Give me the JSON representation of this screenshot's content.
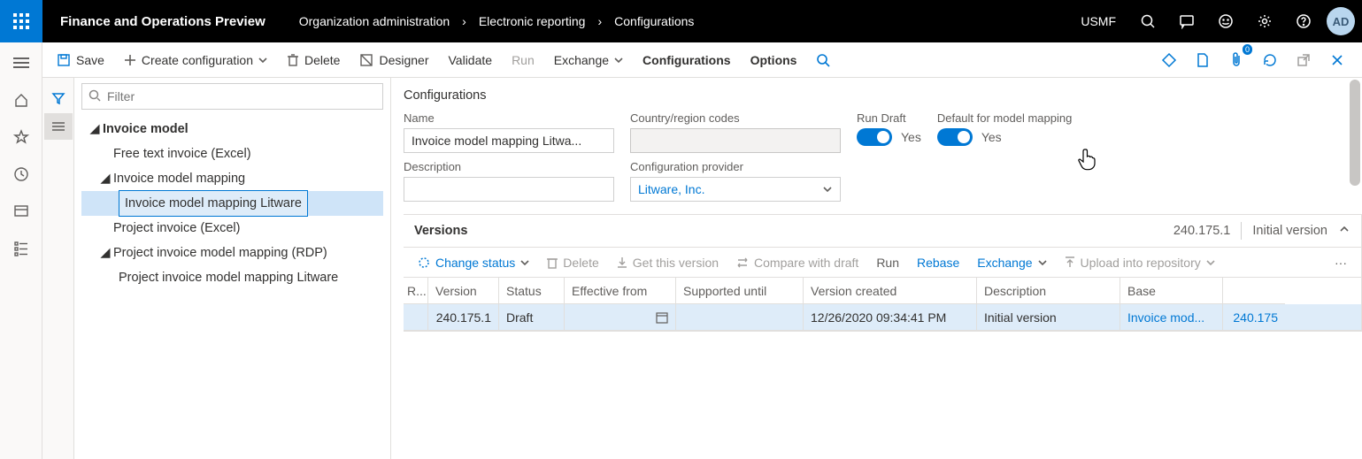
{
  "header": {
    "app_title": "Finance and Operations Preview",
    "breadcrumbs": [
      "Organization administration",
      "Electronic reporting",
      "Configurations"
    ],
    "company": "USMF",
    "avatar": "AD"
  },
  "toolbar": {
    "save": "Save",
    "create": "Create configuration",
    "delete": "Delete",
    "designer": "Designer",
    "validate": "Validate",
    "run": "Run",
    "exchange": "Exchange",
    "configurations": "Configurations",
    "options": "Options"
  },
  "filter": {
    "placeholder": "Filter"
  },
  "tree": {
    "root": "Invoice model",
    "items": [
      "Free text invoice (Excel)",
      "Invoice model mapping",
      "Invoice model mapping Litware",
      "Project invoice (Excel)",
      "Project invoice model mapping (RDP)",
      "Project invoice model mapping Litware"
    ]
  },
  "section": {
    "title": "Configurations",
    "name_label": "Name",
    "name_value": "Invoice model mapping Litwa...",
    "desc_label": "Description",
    "desc_value": "",
    "crc_label": "Country/region codes",
    "crc_value": "",
    "provider_label": "Configuration provider",
    "provider_value": "Litware, Inc.",
    "run_draft_label": "Run Draft",
    "run_draft_value": "Yes",
    "default_mm_label": "Default for model mapping",
    "default_mm_value": "Yes"
  },
  "versions": {
    "title": "Versions",
    "current": "240.175.1",
    "current_desc": "Initial version",
    "tb": {
      "change_status": "Change status",
      "delete": "Delete",
      "get_this": "Get this version",
      "compare": "Compare with draft",
      "run": "Run",
      "rebase": "Rebase",
      "exchange": "Exchange",
      "upload": "Upload into repository"
    },
    "cols": [
      "R...",
      "Version",
      "Status",
      "Effective from",
      "Supported until",
      "Version created",
      "Description",
      "Base",
      ""
    ],
    "rows": [
      {
        "r": "",
        "version": "240.175.1",
        "status": "Draft",
        "eff": "",
        "supp": "",
        "created": "12/26/2020 09:34:41 PM",
        "desc": "Initial version",
        "base": "Invoice mod...",
        "basev": "240.175"
      }
    ]
  }
}
